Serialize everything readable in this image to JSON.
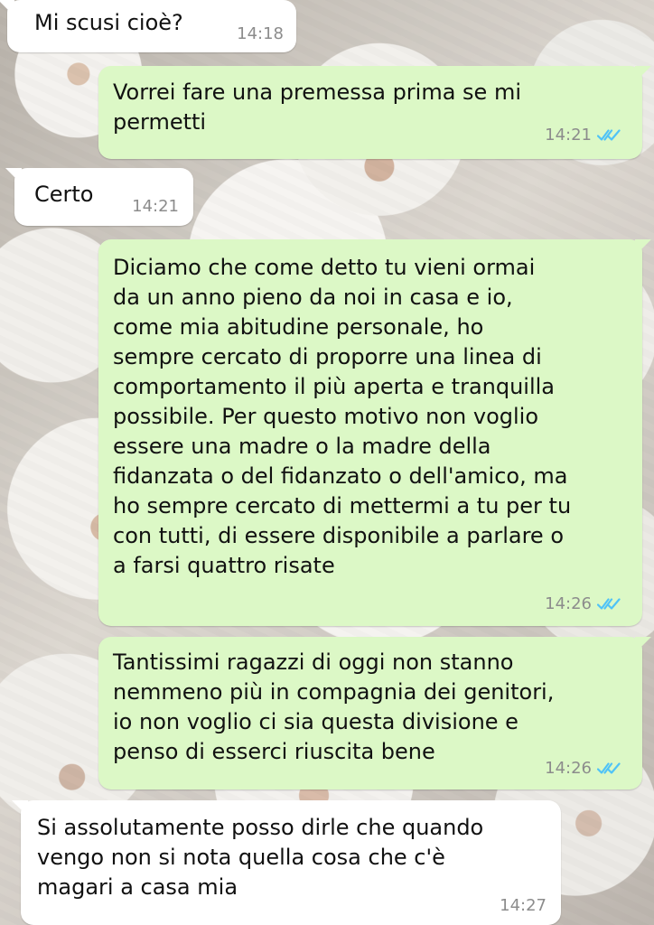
{
  "colors": {
    "incoming_bubble": "#ffffff",
    "outgoing_bubble": "#dcf8c6",
    "timestamp": "#8c8c8c",
    "read_ticks": "#4fc3f7"
  },
  "messages": [
    {
      "direction": "incoming",
      "text": "Mi scusi cioè?",
      "time": "14:18"
    },
    {
      "direction": "outgoing",
      "text": "Vorrei fare una premessa prima se mi\npermetti",
      "time": "14:21",
      "status_icon": "double-check-read-icon"
    },
    {
      "direction": "incoming",
      "text": "Certo",
      "time": "14:21"
    },
    {
      "direction": "outgoing",
      "text": "Diciamo che come detto tu vieni ormai\nda un anno pieno da noi in casa e io,\ncome mia abitudine personale, ho\nsempre cercato di proporre una linea di\ncomportamento il più aperta e tranquilla\npossibile. Per questo motivo non voglio\nessere una madre o la madre della\nfidanzata o del fidanzato o dell'amico, ma\nho sempre cercato di mettermi a tu per tu\ncon tutti, di essere disponibile a parlare o\na farsi quattro risate",
      "time": "14:26",
      "status_icon": "double-check-read-icon"
    },
    {
      "direction": "outgoing",
      "text": "Tantissimi ragazzi di oggi non stanno\nnemmeno più in compagnia dei genitori,\nio non voglio ci sia questa divisione e\npenso di esserci riuscita bene",
      "time": "14:26",
      "status_icon": "double-check-read-icon"
    },
    {
      "direction": "incoming",
      "text": "Si assolutamente posso dirle che quando\nvengo non si nota quella cosa che c'è\nmagari a casa mia",
      "time": "14:27"
    }
  ]
}
